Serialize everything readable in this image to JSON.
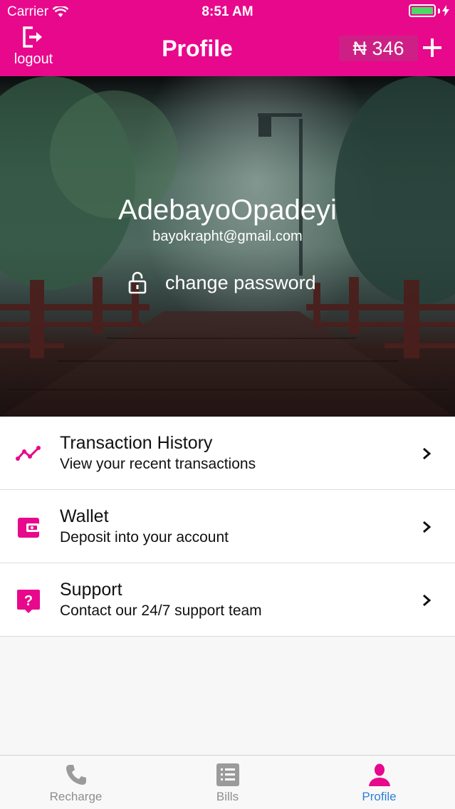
{
  "status_bar": {
    "carrier": "Carrier",
    "time": "8:51 AM"
  },
  "header": {
    "logout_label": "logout",
    "title": "Profile",
    "balance": "₦ 346",
    "logout_icon": "logout-icon",
    "add_icon": "plus-icon"
  },
  "profile": {
    "name": "AdebayoOpadeyi",
    "email": "bayokrapht@gmail.com",
    "change_password_label": "change password",
    "lock_icon": "lock-icon"
  },
  "menu": [
    {
      "title": "Transaction History",
      "subtitle": "View your recent transactions",
      "icon": "trend-chart-icon"
    },
    {
      "title": "Wallet",
      "subtitle": "Deposit into your account",
      "icon": "wallet-icon"
    },
    {
      "title": "Support",
      "subtitle": "Contact our 24/7 support team",
      "icon": "help-chat-icon"
    }
  ],
  "tabs": [
    {
      "label": "Recharge",
      "icon": "phone-icon",
      "active": false
    },
    {
      "label": "Bills",
      "icon": "list-icon",
      "active": false
    },
    {
      "label": "Profile",
      "icon": "person-icon",
      "active": true
    }
  ],
  "colors": {
    "brand": "#e8088c",
    "balance_bg": "#cd1f85",
    "active_tab": "#2f7fd8",
    "inactive_tab": "#8e8e8e"
  }
}
